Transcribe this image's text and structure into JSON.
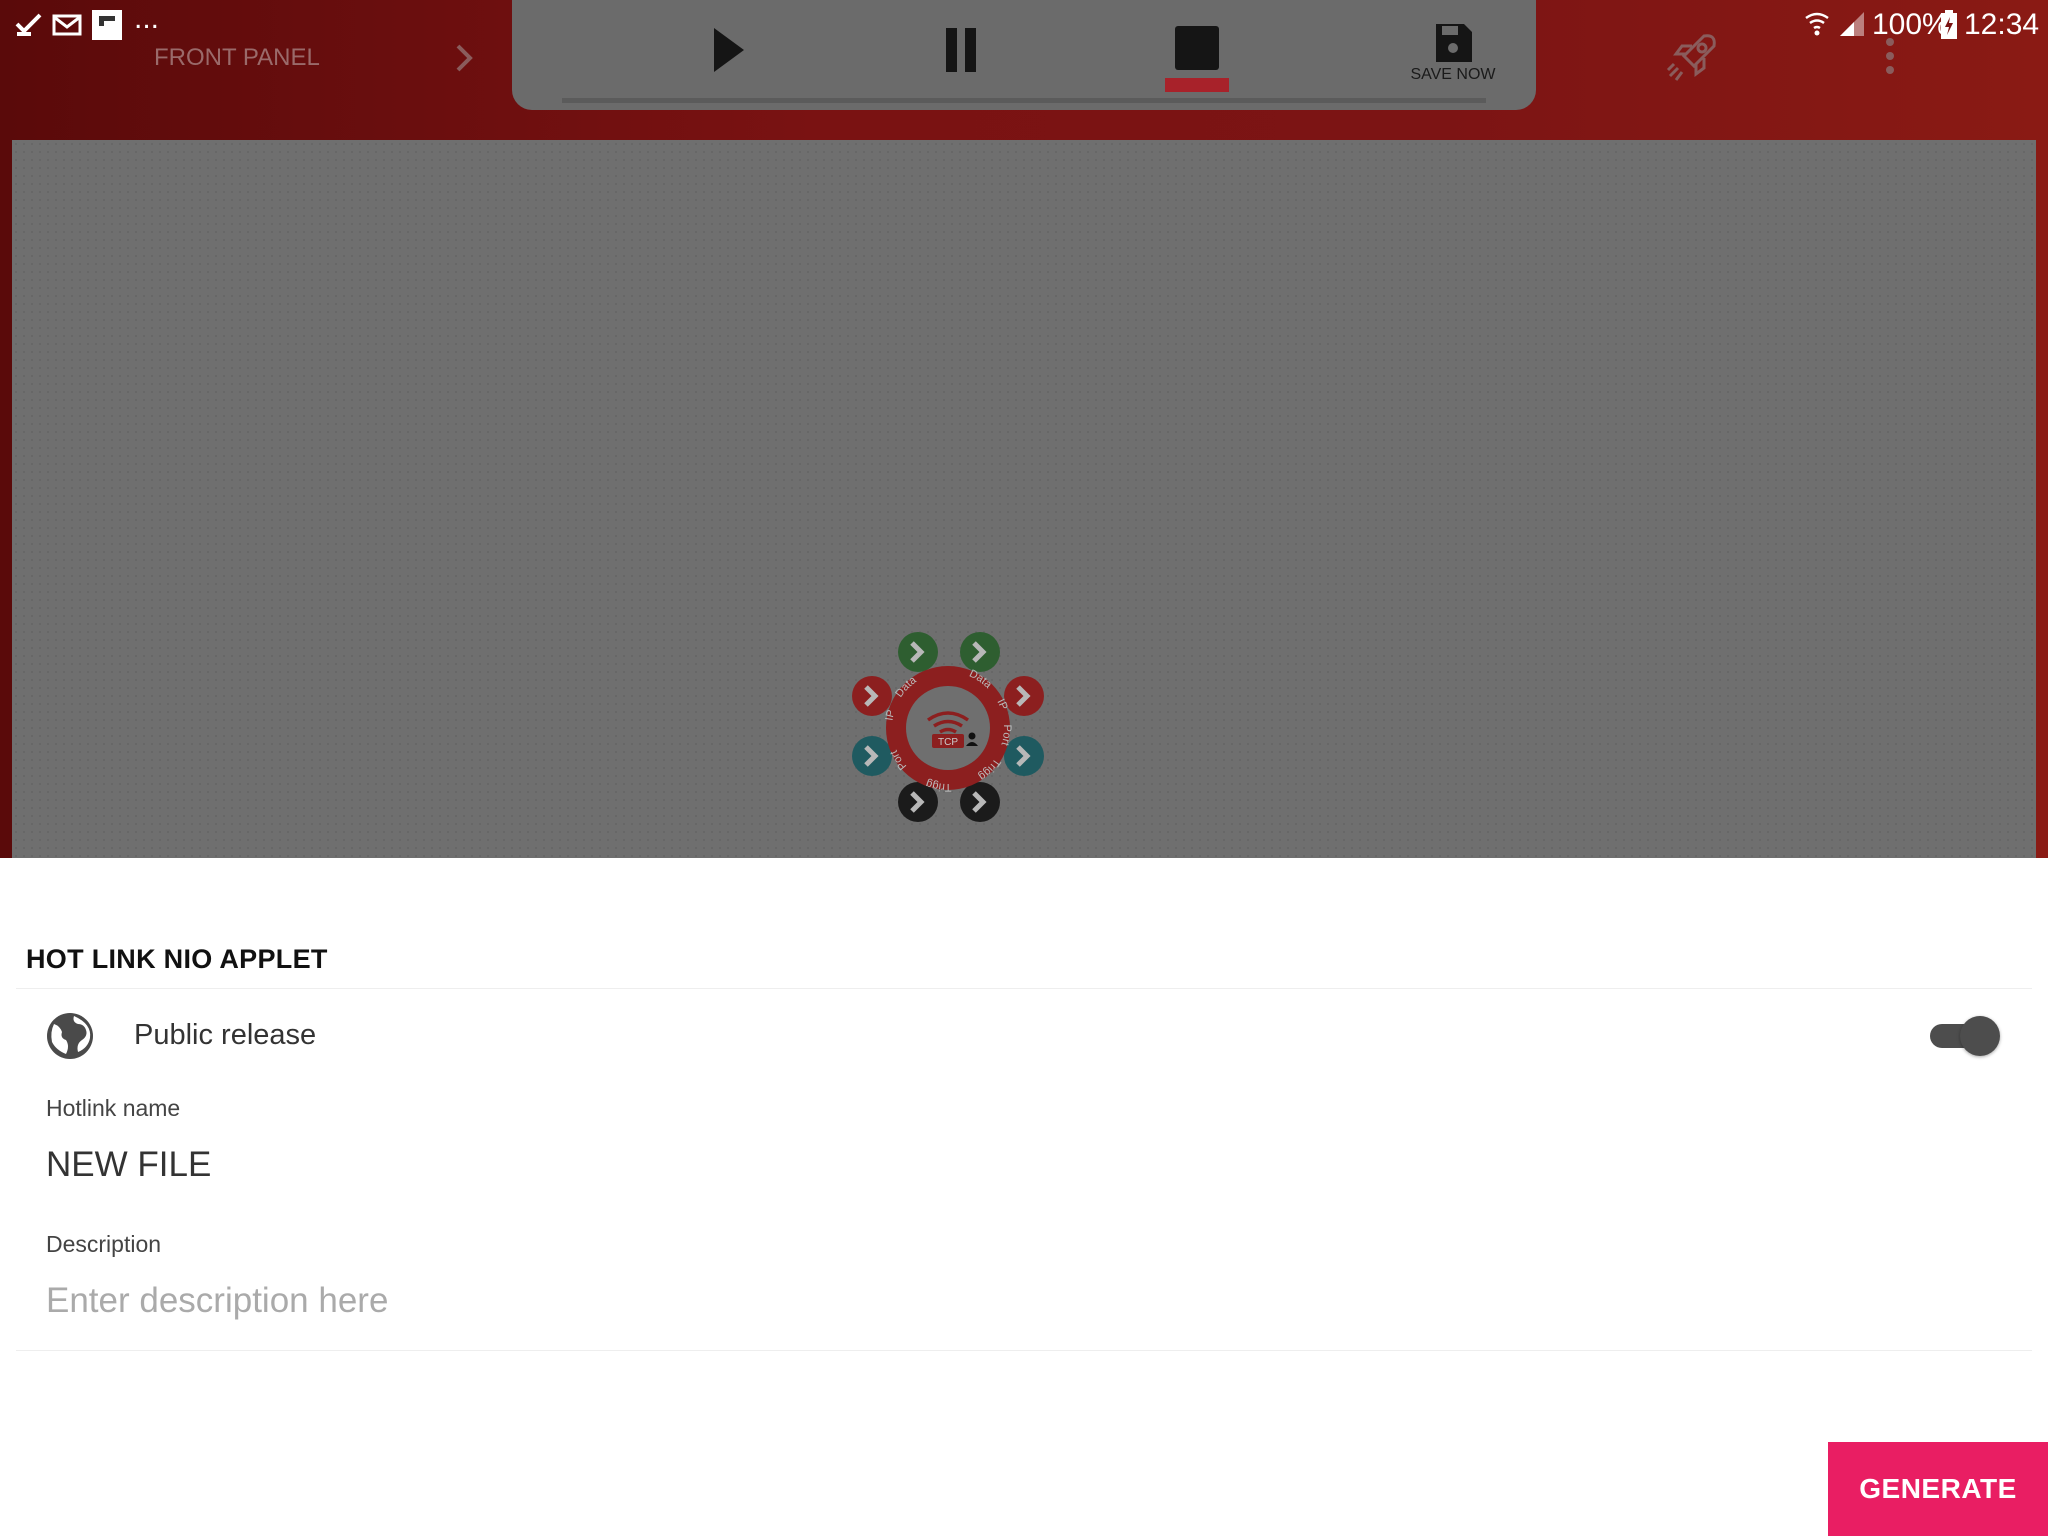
{
  "status_bar": {
    "notification_icons": [
      "checkmark-task-icon",
      "mail-icon",
      "flipboard-icon"
    ],
    "more_notifications": "...",
    "battery": "100%",
    "time": "12:34"
  },
  "app_header": {
    "section_label": "FRONT PANEL",
    "toolbar": {
      "play_icon": "play-icon",
      "pause_icon": "pause-icon",
      "stop_icon": "stop-icon",
      "save_label": "SAVE NOW"
    }
  },
  "node": {
    "center_label": "TCP",
    "ring_labels": [
      "Data",
      "Data",
      "IP",
      "IP",
      "Port",
      "Port",
      "Trigg",
      "Trigg"
    ],
    "port_colors": {
      "data": "#2e7d32",
      "ip": "#c62828",
      "port": "#00838f",
      "trigger": "#212121"
    }
  },
  "sheet": {
    "title": "HOT LINK NIO APPLET",
    "public_release_label": "Public release",
    "public_release_enabled": true,
    "hotlink_name_label": "Hotlink name",
    "hotlink_name_value": "NEW FILE",
    "description_label": "Description",
    "description_placeholder": "Enter description here",
    "generate_label": "GENERATE"
  },
  "colors": {
    "accent": "#e91e63",
    "header": "#7a1212",
    "stop_indicator": "#a8222a"
  }
}
